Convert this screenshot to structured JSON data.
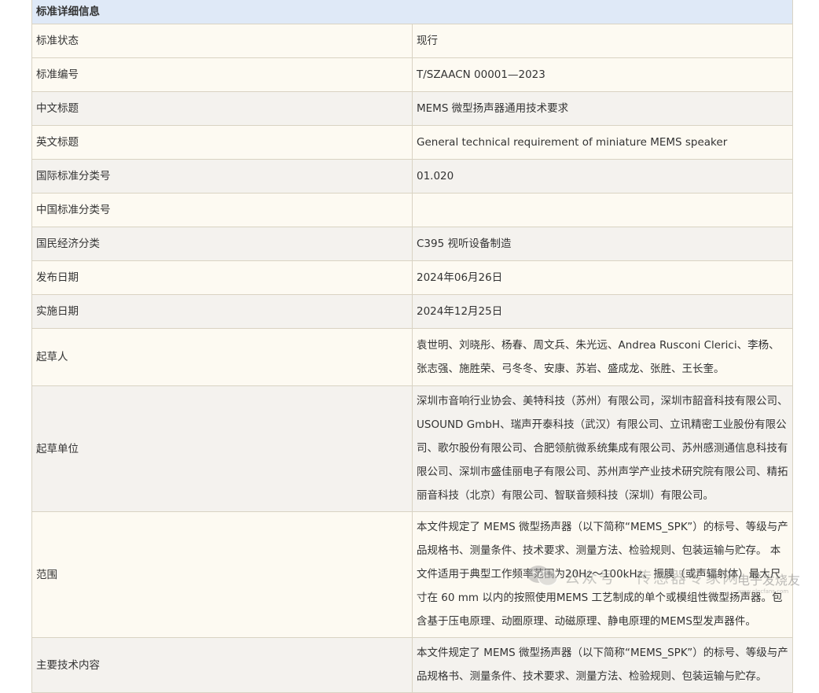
{
  "table": {
    "header": "标准详细信息",
    "rows": [
      {
        "label": "标准状态",
        "value": "现行"
      },
      {
        "label": "标准编号",
        "value": "T/SZAACN 00001—2023"
      },
      {
        "label": "中文标题",
        "value": "MEMS 微型扬声器通用技术要求"
      },
      {
        "label": "英文标题",
        "value": "General technical requirement of miniature MEMS speaker"
      },
      {
        "label": "国际标准分类号",
        "value": "01.020"
      },
      {
        "label": "中国标准分类号",
        "value": ""
      },
      {
        "label": "国民经济分类",
        "value": "C395 视听设备制造"
      },
      {
        "label": "发布日期",
        "value": "2024年06月26日"
      },
      {
        "label": "实施日期",
        "value": "2024年12月25日"
      },
      {
        "label": "起草人",
        "value": "袁世明、刘晓彤、杨春、周文兵、朱光远、Andrea Rusconi Clerici、李杨、张志强、施胜荣、弓冬冬、安康、苏岩、盛成龙、张胜、王长奎。"
      },
      {
        "label": "起草单位",
        "value": "深圳市音响行业协会、美特科技（苏州）有限公司，深圳市韶音科技有限公司、USOUND GmbH、瑞声开泰科技（武汉）有限公司、立讯精密工业股份有限公司、歌尔股份有限公司、合肥领航微系统集成有限公司、苏州感测通信息科技有限公司、深圳市盛佳丽电子有限公司、苏州声学产业技术研究院有限公司、精拓丽音科技（北京）有限公司、智联音频科技（深圳）有限公司。"
      },
      {
        "label": "范围",
        "value": "本文件规定了 MEMS 微型扬声器（以下简称“MEMS_SPK”）的标号、等级与产品规格书、测量条件、技术要求、测量方法、检验规则、包装运输与贮存。 本文件适用于典型工作频率范围为20Hz～100kHz、振膜（或声辐射体）最大尺寸在 60 mm 以内的按照使用MEMS 工艺制成的单个或模组性微型扬声器。包含基于压电原理、动圈原理、动磁原理、静电原理的MEMS型发声器件。"
      },
      {
        "label": "主要技术内容",
        "value": "本文件规定了 MEMS 微型扬声器（以下简称“MEMS_SPK”）的标号、等级与产品规格书、测量条件、技术要求、测量方法、检验规则、包装运输与贮存。"
      }
    ]
  },
  "watermark": {
    "text": "公众号 · 传感器专家网",
    "badge_title": "电子发烧友",
    "badge_url": "www.elecfans.com"
  }
}
